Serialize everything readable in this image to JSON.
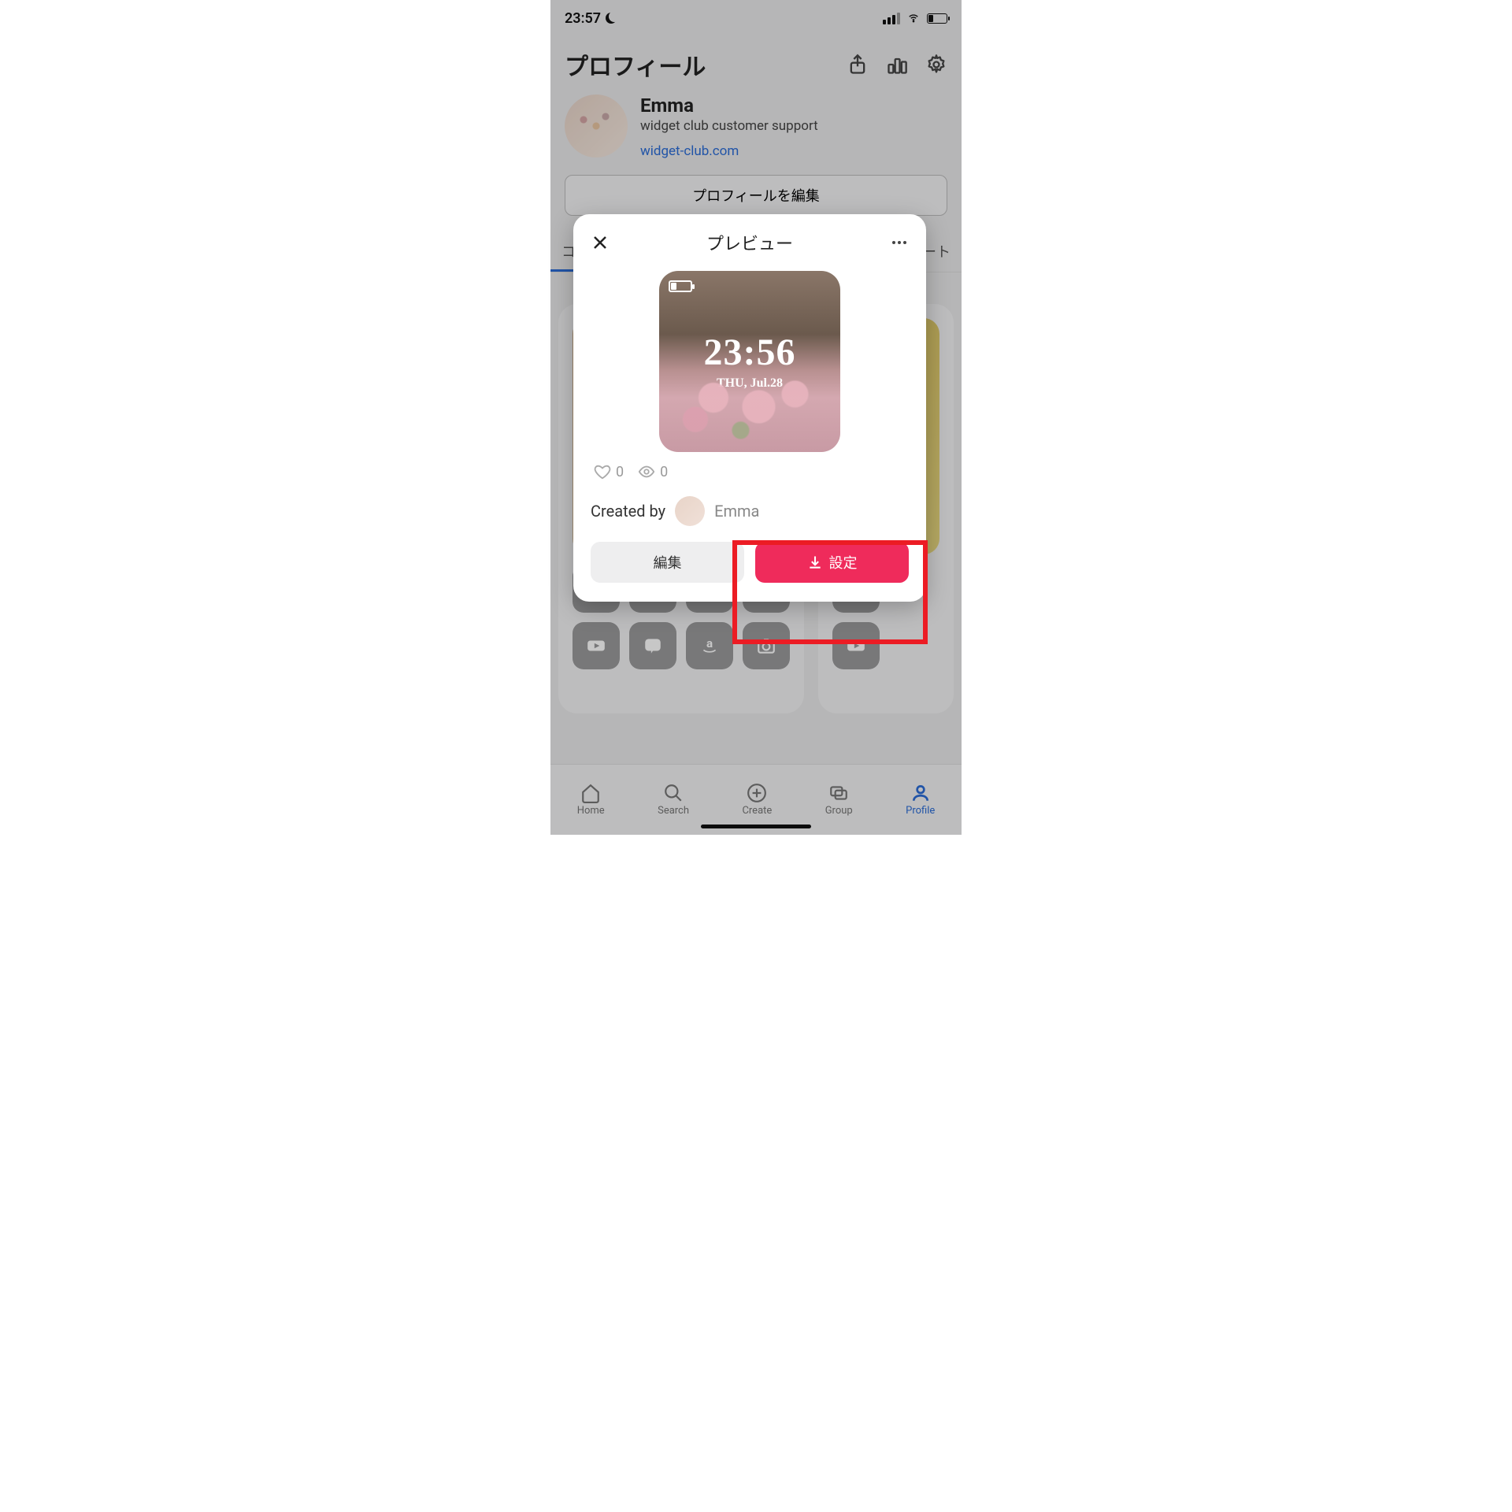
{
  "status": {
    "time": "23:57"
  },
  "header": {
    "title": "プロフィール"
  },
  "profile": {
    "name": "Emma",
    "subtitle": "widget club customer support",
    "link": "widget-club.com",
    "edit_label": "プロフィールを編集"
  },
  "tabs": {
    "left_fragment": "コ",
    "right_fragment": "ート"
  },
  "nav": {
    "home": "Home",
    "search": "Search",
    "create": "Create",
    "group": "Group",
    "profile": "Profile"
  },
  "modal": {
    "title": "プレビュー",
    "preview_time": "23:56",
    "preview_date": "THU, Jul.28",
    "likes": "0",
    "views": "0",
    "created_by_label": "Created by",
    "creator": "Emma",
    "edit_label": "編集",
    "set_label": "設定"
  }
}
